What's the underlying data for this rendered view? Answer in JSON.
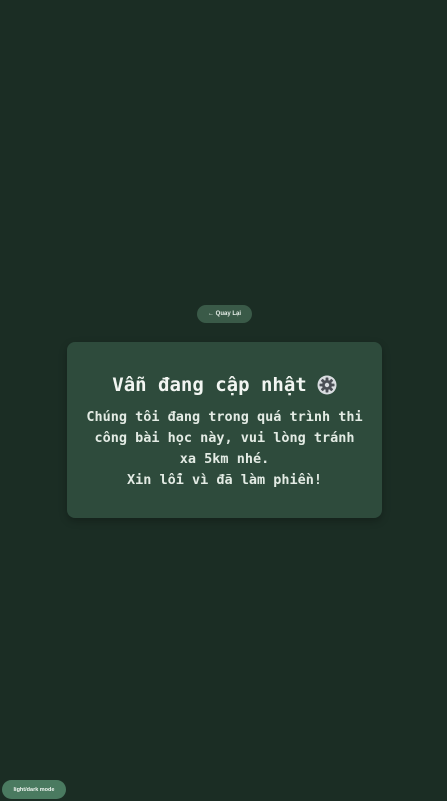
{
  "back_button": {
    "label": "← Quay Lại"
  },
  "card": {
    "title": "Vẫn đang cập nhật",
    "title_icon": "gear-icon",
    "message_lines": [
      "Chúng tôi đang trong quá trình thi công bài học này, vui lòng tránh xa 5km nhé.",
      "Xin lỗi vì đã làm phiền!"
    ]
  },
  "mode_toggle": {
    "label": "light/dark mode"
  },
  "colors": {
    "background": "#1b2d24",
    "card": "#2e4b3c",
    "button": "#3a5a48",
    "toggle": "#4a7a60",
    "text": "#e9efe9"
  }
}
